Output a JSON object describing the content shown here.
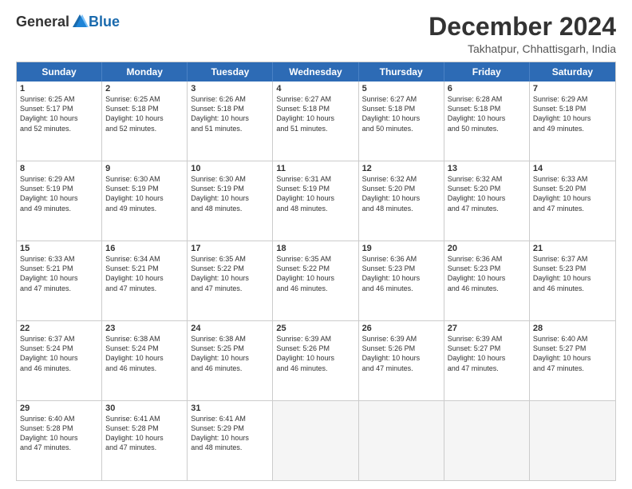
{
  "logo": {
    "general": "General",
    "blue": "Blue"
  },
  "header": {
    "title": "December 2024",
    "subtitle": "Takhatpur, Chhattisgarh, India"
  },
  "days_of_week": [
    "Sunday",
    "Monday",
    "Tuesday",
    "Wednesday",
    "Thursday",
    "Friday",
    "Saturday"
  ],
  "weeks": [
    [
      {
        "day": "1",
        "text": "Sunrise: 6:25 AM\nSunset: 5:17 PM\nDaylight: 10 hours\nand 52 minutes."
      },
      {
        "day": "2",
        "text": "Sunrise: 6:25 AM\nSunset: 5:18 PM\nDaylight: 10 hours\nand 52 minutes."
      },
      {
        "day": "3",
        "text": "Sunrise: 6:26 AM\nSunset: 5:18 PM\nDaylight: 10 hours\nand 51 minutes."
      },
      {
        "day": "4",
        "text": "Sunrise: 6:27 AM\nSunset: 5:18 PM\nDaylight: 10 hours\nand 51 minutes."
      },
      {
        "day": "5",
        "text": "Sunrise: 6:27 AM\nSunset: 5:18 PM\nDaylight: 10 hours\nand 50 minutes."
      },
      {
        "day": "6",
        "text": "Sunrise: 6:28 AM\nSunset: 5:18 PM\nDaylight: 10 hours\nand 50 minutes."
      },
      {
        "day": "7",
        "text": "Sunrise: 6:29 AM\nSunset: 5:18 PM\nDaylight: 10 hours\nand 49 minutes."
      }
    ],
    [
      {
        "day": "8",
        "text": "Sunrise: 6:29 AM\nSunset: 5:19 PM\nDaylight: 10 hours\nand 49 minutes."
      },
      {
        "day": "9",
        "text": "Sunrise: 6:30 AM\nSunset: 5:19 PM\nDaylight: 10 hours\nand 49 minutes."
      },
      {
        "day": "10",
        "text": "Sunrise: 6:30 AM\nSunset: 5:19 PM\nDaylight: 10 hours\nand 48 minutes."
      },
      {
        "day": "11",
        "text": "Sunrise: 6:31 AM\nSunset: 5:19 PM\nDaylight: 10 hours\nand 48 minutes."
      },
      {
        "day": "12",
        "text": "Sunrise: 6:32 AM\nSunset: 5:20 PM\nDaylight: 10 hours\nand 48 minutes."
      },
      {
        "day": "13",
        "text": "Sunrise: 6:32 AM\nSunset: 5:20 PM\nDaylight: 10 hours\nand 47 minutes."
      },
      {
        "day": "14",
        "text": "Sunrise: 6:33 AM\nSunset: 5:20 PM\nDaylight: 10 hours\nand 47 minutes."
      }
    ],
    [
      {
        "day": "15",
        "text": "Sunrise: 6:33 AM\nSunset: 5:21 PM\nDaylight: 10 hours\nand 47 minutes."
      },
      {
        "day": "16",
        "text": "Sunrise: 6:34 AM\nSunset: 5:21 PM\nDaylight: 10 hours\nand 47 minutes."
      },
      {
        "day": "17",
        "text": "Sunrise: 6:35 AM\nSunset: 5:22 PM\nDaylight: 10 hours\nand 47 minutes."
      },
      {
        "day": "18",
        "text": "Sunrise: 6:35 AM\nSunset: 5:22 PM\nDaylight: 10 hours\nand 46 minutes."
      },
      {
        "day": "19",
        "text": "Sunrise: 6:36 AM\nSunset: 5:23 PM\nDaylight: 10 hours\nand 46 minutes."
      },
      {
        "day": "20",
        "text": "Sunrise: 6:36 AM\nSunset: 5:23 PM\nDaylight: 10 hours\nand 46 minutes."
      },
      {
        "day": "21",
        "text": "Sunrise: 6:37 AM\nSunset: 5:23 PM\nDaylight: 10 hours\nand 46 minutes."
      }
    ],
    [
      {
        "day": "22",
        "text": "Sunrise: 6:37 AM\nSunset: 5:24 PM\nDaylight: 10 hours\nand 46 minutes."
      },
      {
        "day": "23",
        "text": "Sunrise: 6:38 AM\nSunset: 5:24 PM\nDaylight: 10 hours\nand 46 minutes."
      },
      {
        "day": "24",
        "text": "Sunrise: 6:38 AM\nSunset: 5:25 PM\nDaylight: 10 hours\nand 46 minutes."
      },
      {
        "day": "25",
        "text": "Sunrise: 6:39 AM\nSunset: 5:26 PM\nDaylight: 10 hours\nand 46 minutes."
      },
      {
        "day": "26",
        "text": "Sunrise: 6:39 AM\nSunset: 5:26 PM\nDaylight: 10 hours\nand 47 minutes."
      },
      {
        "day": "27",
        "text": "Sunrise: 6:39 AM\nSunset: 5:27 PM\nDaylight: 10 hours\nand 47 minutes."
      },
      {
        "day": "28",
        "text": "Sunrise: 6:40 AM\nSunset: 5:27 PM\nDaylight: 10 hours\nand 47 minutes."
      }
    ],
    [
      {
        "day": "29",
        "text": "Sunrise: 6:40 AM\nSunset: 5:28 PM\nDaylight: 10 hours\nand 47 minutes."
      },
      {
        "day": "30",
        "text": "Sunrise: 6:41 AM\nSunset: 5:28 PM\nDaylight: 10 hours\nand 47 minutes."
      },
      {
        "day": "31",
        "text": "Sunrise: 6:41 AM\nSunset: 5:29 PM\nDaylight: 10 hours\nand 48 minutes."
      },
      {
        "day": "",
        "text": ""
      },
      {
        "day": "",
        "text": ""
      },
      {
        "day": "",
        "text": ""
      },
      {
        "day": "",
        "text": ""
      }
    ]
  ]
}
